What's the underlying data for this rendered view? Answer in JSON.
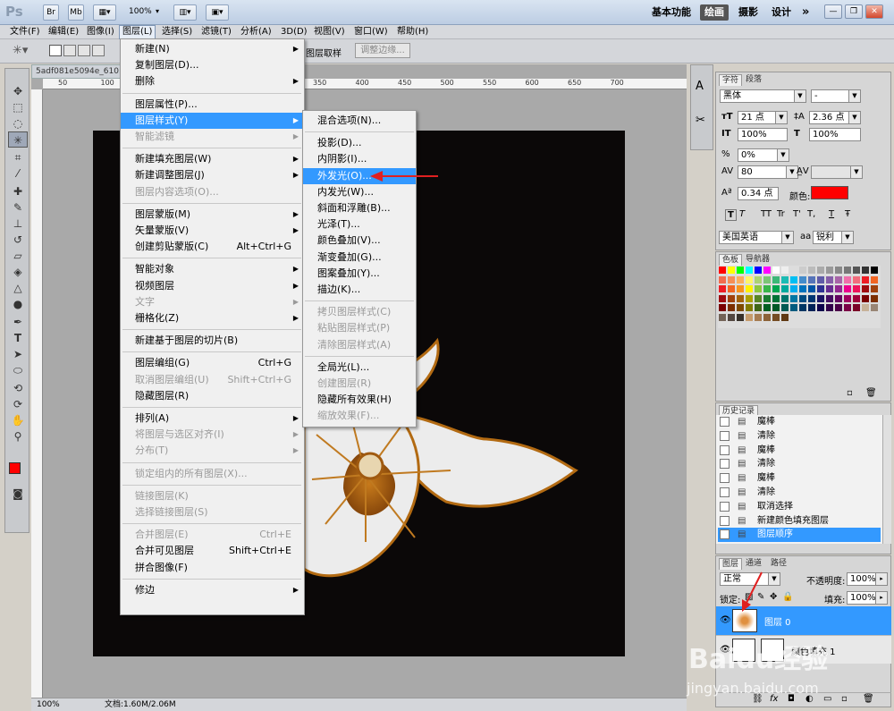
{
  "app": {
    "logo": "Ps",
    "bridge_btn": "Br",
    "minibridge_btn": "Mb",
    "zoom": "100%",
    "workspaces": [
      "基本功能",
      "绘画",
      "摄影",
      "设计"
    ],
    "active_workspace": "绘画",
    "more": "»"
  },
  "menubar": [
    "文件(F)",
    "编辑(E)",
    "图像(I)",
    "图层(L)",
    "选择(S)",
    "滤镜(T)",
    "分析(A)",
    "3D(D)",
    "视图(V)",
    "窗口(W)",
    "帮助(H)"
  ],
  "options": {
    "sample_label": "图层取样",
    "refine_edge": "调整边缘..."
  },
  "document": {
    "tab_title": "5adf081e5094e_610.j",
    "ruler_marks": [
      "50",
      "100",
      "150",
      "200",
      "250",
      "300",
      "350",
      "400",
      "450",
      "500",
      "550",
      "600",
      "650",
      "700"
    ],
    "status_zoom": "100%",
    "status_doc": "文档:1.60M/2.06M"
  },
  "layer_menu": {
    "items": [
      {
        "label": "新建(N)",
        "shortcut": "",
        "submenu": true,
        "disabled": false
      },
      {
        "label": "复制图层(D)...",
        "shortcut": "",
        "submenu": false,
        "disabled": false
      },
      {
        "label": "删除",
        "shortcut": "",
        "submenu": true,
        "disabled": false
      },
      {
        "label": "图层属性(P)...",
        "shortcut": "",
        "submenu": false,
        "disabled": false
      },
      {
        "label": "图层样式(Y)",
        "shortcut": "",
        "submenu": true,
        "disabled": false,
        "highlighted": true
      },
      {
        "label": "智能滤镜",
        "shortcut": "",
        "submenu": true,
        "disabled": true
      },
      {
        "label": "新建填充图层(W)",
        "shortcut": "",
        "submenu": true,
        "disabled": false
      },
      {
        "label": "新建调整图层(J)",
        "shortcut": "",
        "submenu": true,
        "disabled": false
      },
      {
        "label": "图层内容选项(O)...",
        "shortcut": "",
        "submenu": false,
        "disabled": true
      },
      {
        "label": "图层蒙版(M)",
        "shortcut": "",
        "submenu": true,
        "disabled": false
      },
      {
        "label": "矢量蒙版(V)",
        "shortcut": "",
        "submenu": true,
        "disabled": false
      },
      {
        "label": "创建剪贴蒙版(C)",
        "shortcut": "Alt+Ctrl+G",
        "submenu": false,
        "disabled": false
      },
      {
        "label": "智能对象",
        "shortcut": "",
        "submenu": true,
        "disabled": false
      },
      {
        "label": "视频图层",
        "shortcut": "",
        "submenu": true,
        "disabled": false
      },
      {
        "label": "文字",
        "shortcut": "",
        "submenu": true,
        "disabled": true
      },
      {
        "label": "栅格化(Z)",
        "shortcut": "",
        "submenu": true,
        "disabled": false
      },
      {
        "label": "新建基于图层的切片(B)",
        "shortcut": "",
        "submenu": false,
        "disabled": false
      },
      {
        "label": "图层编组(G)",
        "shortcut": "Ctrl+G",
        "submenu": false,
        "disabled": false
      },
      {
        "label": "取消图层编组(U)",
        "shortcut": "Shift+Ctrl+G",
        "submenu": false,
        "disabled": true
      },
      {
        "label": "隐藏图层(R)",
        "shortcut": "",
        "submenu": false,
        "disabled": false
      },
      {
        "label": "排列(A)",
        "shortcut": "",
        "submenu": true,
        "disabled": false
      },
      {
        "label": "将图层与选区对齐(I)",
        "shortcut": "",
        "submenu": true,
        "disabled": true
      },
      {
        "label": "分布(T)",
        "shortcut": "",
        "submenu": true,
        "disabled": true
      },
      {
        "label": "锁定组内的所有图层(X)...",
        "shortcut": "",
        "submenu": false,
        "disabled": true
      },
      {
        "label": "链接图层(K)",
        "shortcut": "",
        "submenu": false,
        "disabled": true
      },
      {
        "label": "选择链接图层(S)",
        "shortcut": "",
        "submenu": false,
        "disabled": true
      },
      {
        "label": "合并图层(E)",
        "shortcut": "Ctrl+E",
        "submenu": false,
        "disabled": true
      },
      {
        "label": "合并可见图层",
        "shortcut": "Shift+Ctrl+E",
        "submenu": false,
        "disabled": false
      },
      {
        "label": "拼合图像(F)",
        "shortcut": "",
        "submenu": false,
        "disabled": false
      },
      {
        "label": "修边",
        "shortcut": "",
        "submenu": true,
        "disabled": false
      }
    ]
  },
  "style_menu": {
    "items": [
      {
        "label": "混合选项(N)...",
        "disabled": false
      },
      {
        "label": "投影(D)...",
        "disabled": false
      },
      {
        "label": "内阴影(I)...",
        "disabled": false
      },
      {
        "label": "外发光(O)...",
        "disabled": false,
        "highlighted": true
      },
      {
        "label": "内发光(W)...",
        "disabled": false
      },
      {
        "label": "斜面和浮雕(B)...",
        "disabled": false
      },
      {
        "label": "光泽(T)...",
        "disabled": false
      },
      {
        "label": "颜色叠加(V)...",
        "disabled": false
      },
      {
        "label": "渐变叠加(G)...",
        "disabled": false
      },
      {
        "label": "图案叠加(Y)...",
        "disabled": false
      },
      {
        "label": "描边(K)...",
        "disabled": false
      },
      {
        "label": "拷贝图层样式(C)",
        "disabled": true
      },
      {
        "label": "粘贴图层样式(P)",
        "disabled": true
      },
      {
        "label": "清除图层样式(A)",
        "disabled": true
      },
      {
        "label": "全局光(L)...",
        "disabled": false
      },
      {
        "label": "创建图层(R)",
        "disabled": true
      },
      {
        "label": "隐藏所有效果(H)",
        "disabled": false
      },
      {
        "label": "缩放效果(F)...",
        "disabled": true
      }
    ]
  },
  "char_panel": {
    "tabs": [
      "字符",
      "段落"
    ],
    "font": "黑体",
    "style": "-",
    "size": "21 点",
    "leading": "2.36 点",
    "vscale": "100%",
    "hscale": "100%",
    "kerning": "0%",
    "tracking": "80",
    "baseline": "0.34 点",
    "color_label": "颜色:",
    "color": "#ff0000",
    "language": "美国英语",
    "aa_label": "aa",
    "antialias": "锐利",
    "style_buttons": [
      "T",
      "T",
      "TT",
      "Tr",
      "T'",
      "T,",
      "T",
      "Ŧ"
    ]
  },
  "swatch_panel": {
    "tabs": [
      "色板",
      "导航器"
    ]
  },
  "history_panel": {
    "tab": "历史记录",
    "items": [
      "魔棒",
      "清除",
      "魔棒",
      "清除",
      "魔棒",
      "清除",
      "取消选择",
      "新建颜色填充图层",
      "图层顺序"
    ],
    "active": "图层顺序"
  },
  "layers_panel": {
    "tabs": [
      "图层",
      "通道",
      "路径"
    ],
    "blend": "正常",
    "opacity_label": "不透明度:",
    "opacity": "100%",
    "lock_label": "锁定:",
    "fill_label": "填充:",
    "fill": "100%",
    "layers": [
      {
        "name": "图层 0",
        "selected": true
      },
      {
        "name": "颜色填充 1",
        "selected": false
      }
    ]
  },
  "watermark": {
    "brand": "Baidu经验",
    "url": "jingyan.baidu.com"
  },
  "colors": {
    "accent": "#3399ff",
    "fg": "#ff0000",
    "bg": "#00cc00",
    "canvas": "#0b0808",
    "arrow": "#e02020"
  }
}
